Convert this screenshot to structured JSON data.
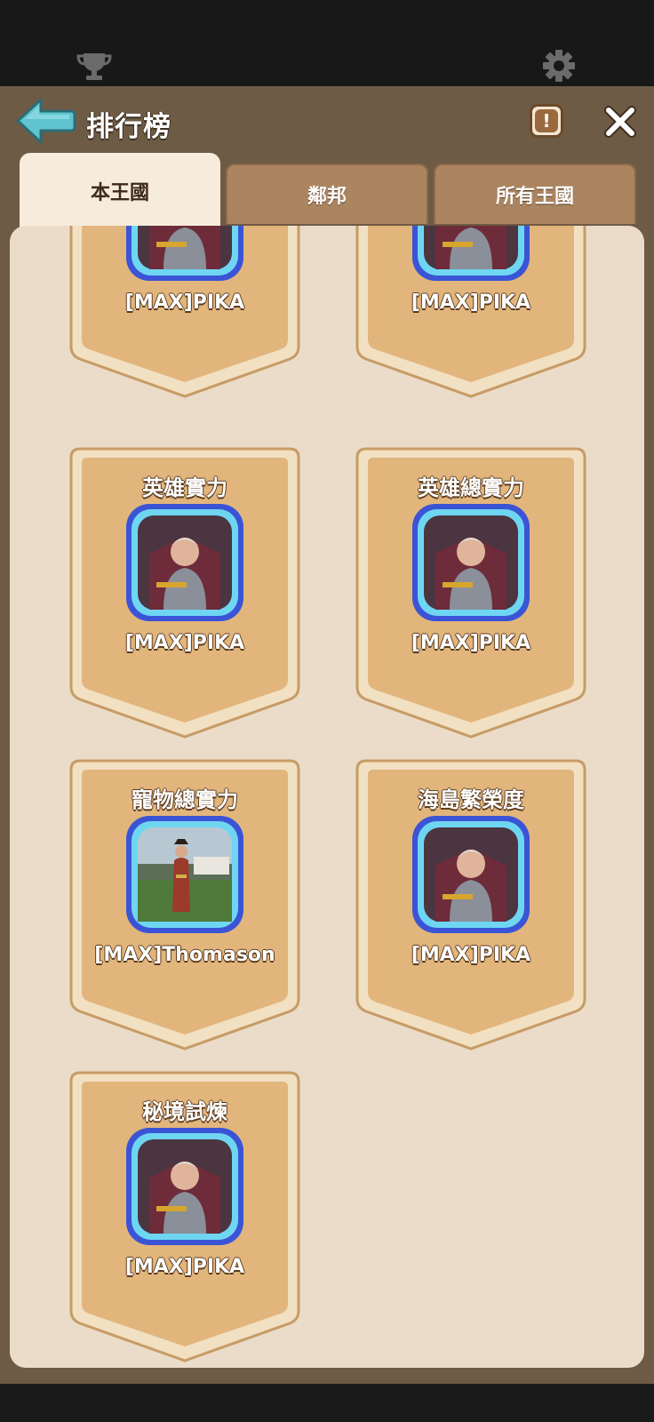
{
  "header": {
    "title": "排行榜",
    "info_label": "!"
  },
  "tabs": [
    {
      "label": "本王國",
      "active": true
    },
    {
      "label": "鄰邦",
      "active": false
    },
    {
      "label": "所有王國",
      "active": false
    }
  ],
  "cards": [
    {
      "category": "",
      "player": "[MAX]PIKA",
      "avatar": "king-portrait"
    },
    {
      "category": "",
      "player": "[MAX]PIKA",
      "avatar": "king-portrait"
    },
    {
      "category": "英雄實力",
      "player": "[MAX]PIKA",
      "avatar": "king-portrait"
    },
    {
      "category": "英雄總實力",
      "player": "[MAX]PIKA",
      "avatar": "king-portrait"
    },
    {
      "category": "寵物總實力",
      "player": "[MAX]Thomason",
      "avatar": "pirate-photo"
    },
    {
      "category": "海島繁榮度",
      "player": "[MAX]PIKA",
      "avatar": "king-portrait"
    },
    {
      "category": "秘境試煉",
      "player": "[MAX]PIKA",
      "avatar": "king-portrait"
    }
  ],
  "colors": {
    "frame": "#6e5b45",
    "panel": "#eadcc8",
    "card": "#e3b67c",
    "accent": "#5fb8c4"
  }
}
